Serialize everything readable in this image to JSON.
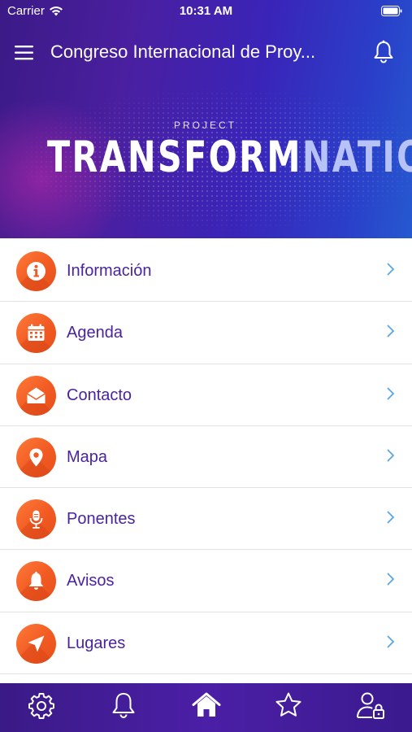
{
  "status_bar": {
    "carrier": "Carrier",
    "time": "10:31 AM"
  },
  "nav": {
    "title": "Congreso Internacional de Proy..."
  },
  "banner": {
    "project": "PROJECT",
    "brand_part1": "TRANSFORM",
    "brand_part2": "NATION"
  },
  "menu": {
    "items": [
      {
        "label": "Información",
        "icon": "info-icon"
      },
      {
        "label": "Agenda",
        "icon": "calendar-icon"
      },
      {
        "label": "Contacto",
        "icon": "envelope-icon"
      },
      {
        "label": "Mapa",
        "icon": "map-pin-icon"
      },
      {
        "label": "Ponentes",
        "icon": "microphone-icon"
      },
      {
        "label": "Avisos",
        "icon": "bell-icon"
      },
      {
        "label": "Lugares",
        "icon": "navigation-arrow-icon"
      }
    ]
  },
  "tab_bar": {
    "tabs": [
      {
        "icon": "gear-icon"
      },
      {
        "icon": "bell-icon"
      },
      {
        "icon": "home-icon",
        "active": true
      },
      {
        "icon": "star-icon"
      },
      {
        "icon": "user-lock-icon"
      }
    ]
  },
  "colors": {
    "accent_orange": "#f15a22",
    "label_purple": "#4a23a0",
    "chevron_blue": "#5aa7e8",
    "bar_purple": "#3b1a86"
  }
}
